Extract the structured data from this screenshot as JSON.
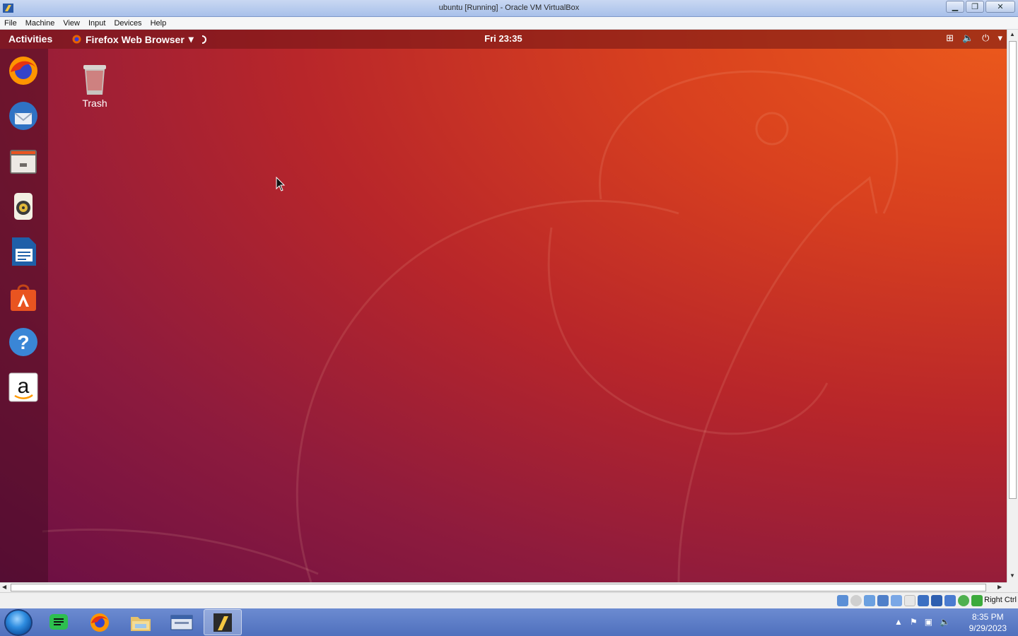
{
  "window": {
    "title": "ubuntu [Running] - Oracle VM VirtualBox",
    "minimize_glyph": "▁",
    "restore_glyph": "❐",
    "close_glyph": "✕"
  },
  "menubar": {
    "items": [
      "File",
      "Machine",
      "View",
      "Input",
      "Devices",
      "Help"
    ]
  },
  "guest": {
    "topbar": {
      "activities": "Activities",
      "app_menu": "Firefox Web Browser",
      "app_menu_arrow": "▾",
      "clock": "Fri 23:35",
      "tray_icons": [
        "network-icon",
        "volume-icon",
        "power-icon"
      ],
      "tray_glyphs": {
        "network": "⊞",
        "volume": "🔈",
        "power": "⏻",
        "menu_arrow": "▾"
      }
    },
    "dock": [
      {
        "name": "firefox-icon",
        "color": "#e66000"
      },
      {
        "name": "thunderbird-icon",
        "color": "#2f72c4"
      },
      {
        "name": "files-icon",
        "color": "#8f8a86"
      },
      {
        "name": "rhythmbox-icon",
        "color": "#e8e3d0"
      },
      {
        "name": "libreoffice-writer-icon",
        "color": "#1f5fa8"
      },
      {
        "name": "ubuntu-software-icon",
        "color": "#e95420"
      },
      {
        "name": "help-icon",
        "color": "#3a86d6"
      },
      {
        "name": "amazon-icon",
        "color": "#ffffff"
      }
    ],
    "desktop": {
      "trash_label": "Trash"
    }
  },
  "statusbar": {
    "host_key": "Right Ctrl"
  },
  "taskbar": {
    "buttons": [
      "chat-app-icon",
      "firefox-icon",
      "file-explorer-icon",
      "window-manager-icon",
      "virtualbox-icon"
    ],
    "clock_time": "8:35 PM",
    "clock_date": "9/29/2023"
  },
  "colors": {
    "ubuntu_orange": "#e95420",
    "aubergine": "#77216f"
  }
}
